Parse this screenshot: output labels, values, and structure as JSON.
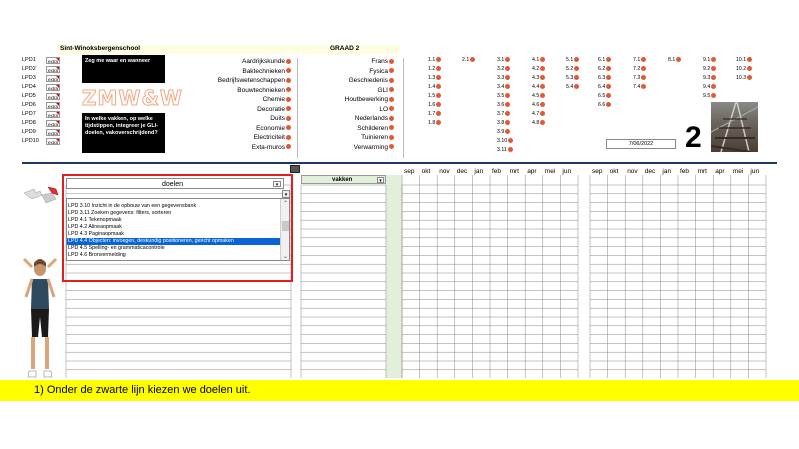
{
  "school": "Sint-Winoksbergenschool",
  "graad": "GRAAD 2",
  "lpd_rows": [
    {
      "code": "LPD1",
      "extra": "extra"
    },
    {
      "code": "LPD2",
      "extra": "extra"
    },
    {
      "code": "LPD3",
      "extra": "extra"
    },
    {
      "code": "LPD4",
      "extra": "extra"
    },
    {
      "code": "LPD5",
      "extra": "extra"
    },
    {
      "code": "LPD6",
      "extra": "extra"
    },
    {
      "code": "LPD7",
      "extra": "extra"
    },
    {
      "code": "LPD8",
      "extra": "extra"
    },
    {
      "code": "LPD9",
      "extra": "extra"
    },
    {
      "code": "LPD10",
      "extra": "extra"
    }
  ],
  "box1_text": "Zeg me waar en wanneer",
  "logo_text": "ZMW&W",
  "box2_text": "In welke vakken, op welke tijdstippen, integreer je GLI-doelen, vakoverschrijdend?",
  "subjects_left": [
    "Aardrijkskunde",
    "Baktechnieken",
    "Bedrijfswetenschappen",
    "Bouwtechnieken",
    "Chemie",
    "Decoratie",
    "Duits",
    "Economie",
    "Electriciteit",
    "Exta-muros"
  ],
  "subjects_right": [
    "Frans",
    "Fysica",
    "Geschiedenis",
    "GLI",
    "Houtbewerking",
    "LO",
    "Nederlands",
    "Schilderen",
    "Tuinieren",
    "Verwarming"
  ],
  "tag_columns": [
    [
      "1.1",
      "1.2",
      "1.3",
      "1.4",
      "1.5",
      "1.6",
      "1.7",
      "1.8"
    ],
    [
      "2.1"
    ],
    [
      "3.1",
      "3.2",
      "3.3",
      "3.4",
      "3.5",
      "3.6",
      "3.7",
      "3.8",
      "3.9",
      "3.10",
      "3.11"
    ],
    [
      "4.1",
      "4.2",
      "4.3",
      "4.4",
      "4.5",
      "4.6",
      "4.7",
      "4.8"
    ],
    [
      "5.1",
      "5.2",
      "5.3",
      "5.4"
    ],
    [
      "6.1",
      "6.2",
      "6.3",
      "6.4",
      "6.5",
      "6.6"
    ],
    [
      "7.1",
      "7.2",
      "7.3",
      "7.4"
    ],
    [
      "8.1"
    ],
    [
      "9.1",
      "9.2",
      "9.3",
      "9.4",
      "9.5"
    ],
    [
      "10.1",
      "10.2",
      "10.3"
    ]
  ],
  "date": "7/06/2022",
  "big_number": "2",
  "doelen_label": "doelen",
  "vakken_label": "vakken",
  "months": [
    "sep",
    "okt",
    "nov",
    "dec",
    "jan",
    "feb",
    "mrt",
    "apr",
    "mei",
    "jun"
  ],
  "dropdown_options": [
    "LPD 3.10 Inzicht in de opbouw van een gegevensbank",
    "LPD 3.11 Zoeken gegevens: filters, sorteren",
    "LPD 4.1 Tekenopmaak",
    "LPD 4.2 Alineaopmaak",
    "LPD 4.3 Paginaopmaak",
    "LPD 4.4 Objecten: invoegen, deskundig positioneren, gericht opmaken",
    "LPD 4.5 Spelling- en grammaticacontrole",
    "LPD 4.6 Bronvermelding"
  ],
  "selected_option_index": 5,
  "caption": "1) Onder de zwarte lijn kiezen we doelen uit.",
  "colors": {
    "highlight_yellow": "#fffde0",
    "selection_blue": "#0a64d6",
    "red_border": "#e0201e",
    "navy_line": "#1f3864",
    "caption_yellow": "#ffff00",
    "green_col": "#e2efda",
    "dot": "#e05a3a"
  }
}
